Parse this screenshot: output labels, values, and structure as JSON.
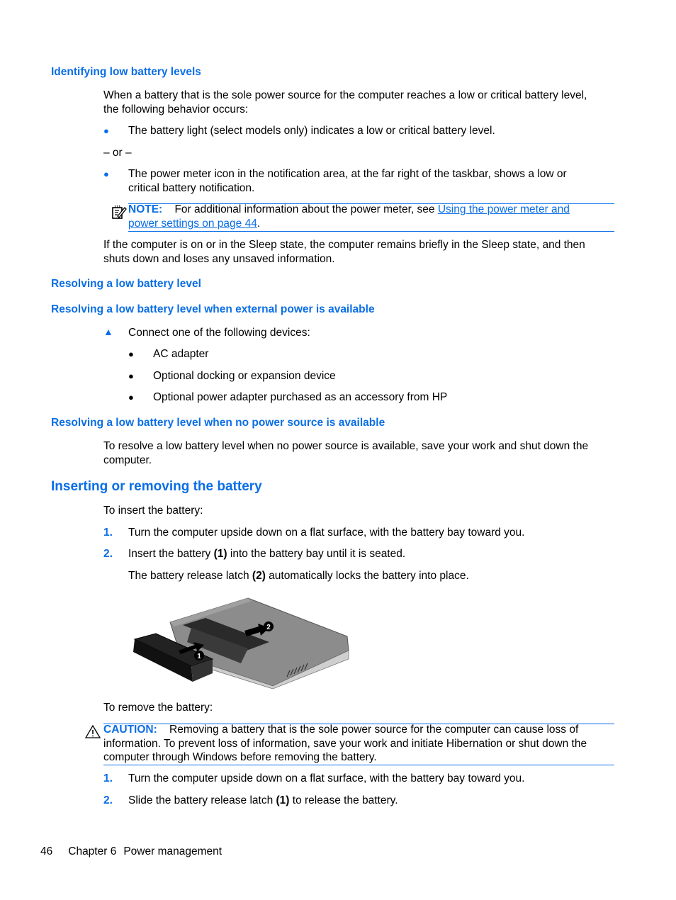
{
  "sections": {
    "identifying": {
      "heading": "Identifying low battery levels",
      "intro": "When a battery that is the sole power source for the computer reaches a low or critical battery level, the following behavior occurs:",
      "intro_line1": "When a battery that is the sole power source for the computer reaches a low or critical battery level,",
      "intro_line2": "the following behavior occurs:",
      "bullet1": "The battery light (select models only) indicates a low or critical battery level.",
      "or_text": "– or –",
      "bullet2_line1": "The power meter icon in the notification area, at the far right of the taskbar, shows a low or",
      "bullet2_line2": "critical battery notification.",
      "note": {
        "label": "NOTE:",
        "text": "For additional information about the power meter, see",
        "link_line1": "Using the power meter and",
        "link_line2": "power settings on page 44",
        "end": "."
      },
      "sleep_line1": "If the computer is on or in the Sleep state, the computer remains briefly in the Sleep state, and then",
      "sleep_line2": "shuts down and loses any unsaved information."
    },
    "resolving": {
      "heading": "Resolving a low battery level",
      "external": {
        "heading": "Resolving a low battery level when external power is available",
        "step": "Connect one of the following devices:",
        "devices": [
          "AC adapter",
          "Optional docking or expansion device",
          "Optional power adapter purchased as an accessory from HP"
        ]
      },
      "no_power": {
        "heading": "Resolving a low battery level when no power source is available",
        "line1": "To resolve a low battery level when no power source is available, save your work and shut down the",
        "line2": "computer."
      }
    },
    "inserting": {
      "heading": "Inserting or removing the battery",
      "insert_intro": "To insert the battery:",
      "insert_steps": [
        {
          "num": "1.",
          "text": "Turn the computer upside down on a flat surface, with the battery bay toward you."
        },
        {
          "num": "2.",
          "pre": "Insert the battery ",
          "bold": "(1)",
          "post": " into the battery bay until it is seated."
        }
      ],
      "latch_pre": "The battery release latch ",
      "latch_bold": "(2)",
      "latch_post": " automatically locks the battery into place.",
      "figure": {
        "callout1": "1",
        "callout2": "2"
      },
      "remove_intro": "To remove the battery:",
      "caution": {
        "label": "CAUTION:",
        "line1": "Removing a battery that is the sole power source for the computer can cause loss of",
        "line2": "information. To prevent loss of information, save your work and initiate Hibernation or shut down the",
        "line3": "computer through Windows before removing the battery."
      },
      "remove_steps": [
        {
          "num": "1.",
          "text": "Turn the computer upside down on a flat surface, with the battery bay toward you."
        },
        {
          "num": "2.",
          "pre": "Slide the battery release latch ",
          "bold": "(1)",
          "post": " to release the battery."
        }
      ]
    }
  },
  "footer": {
    "page_number": "46",
    "chapter": "Chapter 6",
    "title": "Power management"
  }
}
